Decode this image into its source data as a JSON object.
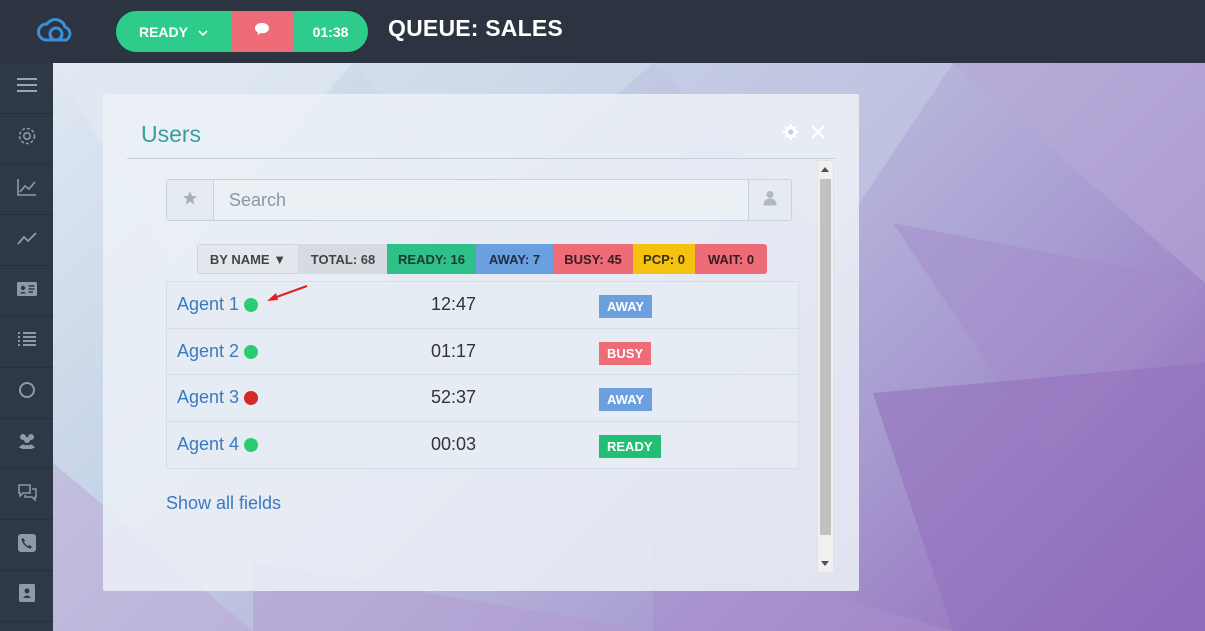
{
  "colors": {
    "ready": "#2ecc8a",
    "busy": "#ee6b78",
    "away": "#6aa0e0",
    "pcp": "#f5c20f",
    "link": "#3b79c0",
    "title": "#3b9e9e",
    "online_dot": "#2ecc71",
    "offline_dot": "#d62828"
  },
  "topbar": {
    "logo": "cloud-logo",
    "status_label": "READY",
    "chat_icon": "chat-bubble-icon",
    "timer": "01:38",
    "queue_title": "QUEUE: SALES"
  },
  "sidebar": {
    "items": [
      {
        "icon": "menu-icon"
      },
      {
        "icon": "gear-icon"
      },
      {
        "icon": "area-chart-icon"
      },
      {
        "icon": "line-chart-icon"
      },
      {
        "icon": "id-card-icon"
      },
      {
        "icon": "list-icon"
      },
      {
        "icon": "circle-icon"
      },
      {
        "icon": "users-icon"
      },
      {
        "icon": "chat-icon"
      },
      {
        "icon": "phone-icon"
      },
      {
        "icon": "contact-book-icon"
      }
    ]
  },
  "panel": {
    "title": "Users",
    "search_placeholder": "Search",
    "filters": {
      "sort": "BY NAME ▼",
      "total": "TOTAL: 68",
      "ready": "READY: 16",
      "away": "AWAY: 7",
      "busy": "BUSY: 45",
      "pcp": "PCP: 0",
      "wait": "WAIT: 0"
    },
    "agents": [
      {
        "name": "Agent 1",
        "dot": "green",
        "time": "12:47",
        "status": "AWAY"
      },
      {
        "name": "Agent 2",
        "dot": "green",
        "time": "01:17",
        "status": "BUSY"
      },
      {
        "name": "Agent 3",
        "dot": "red",
        "time": "52:37",
        "status": "AWAY"
      },
      {
        "name": "Agent 4",
        "dot": "green",
        "time": "00:03",
        "status": "READY"
      }
    ],
    "show_all": "Show all fields"
  }
}
